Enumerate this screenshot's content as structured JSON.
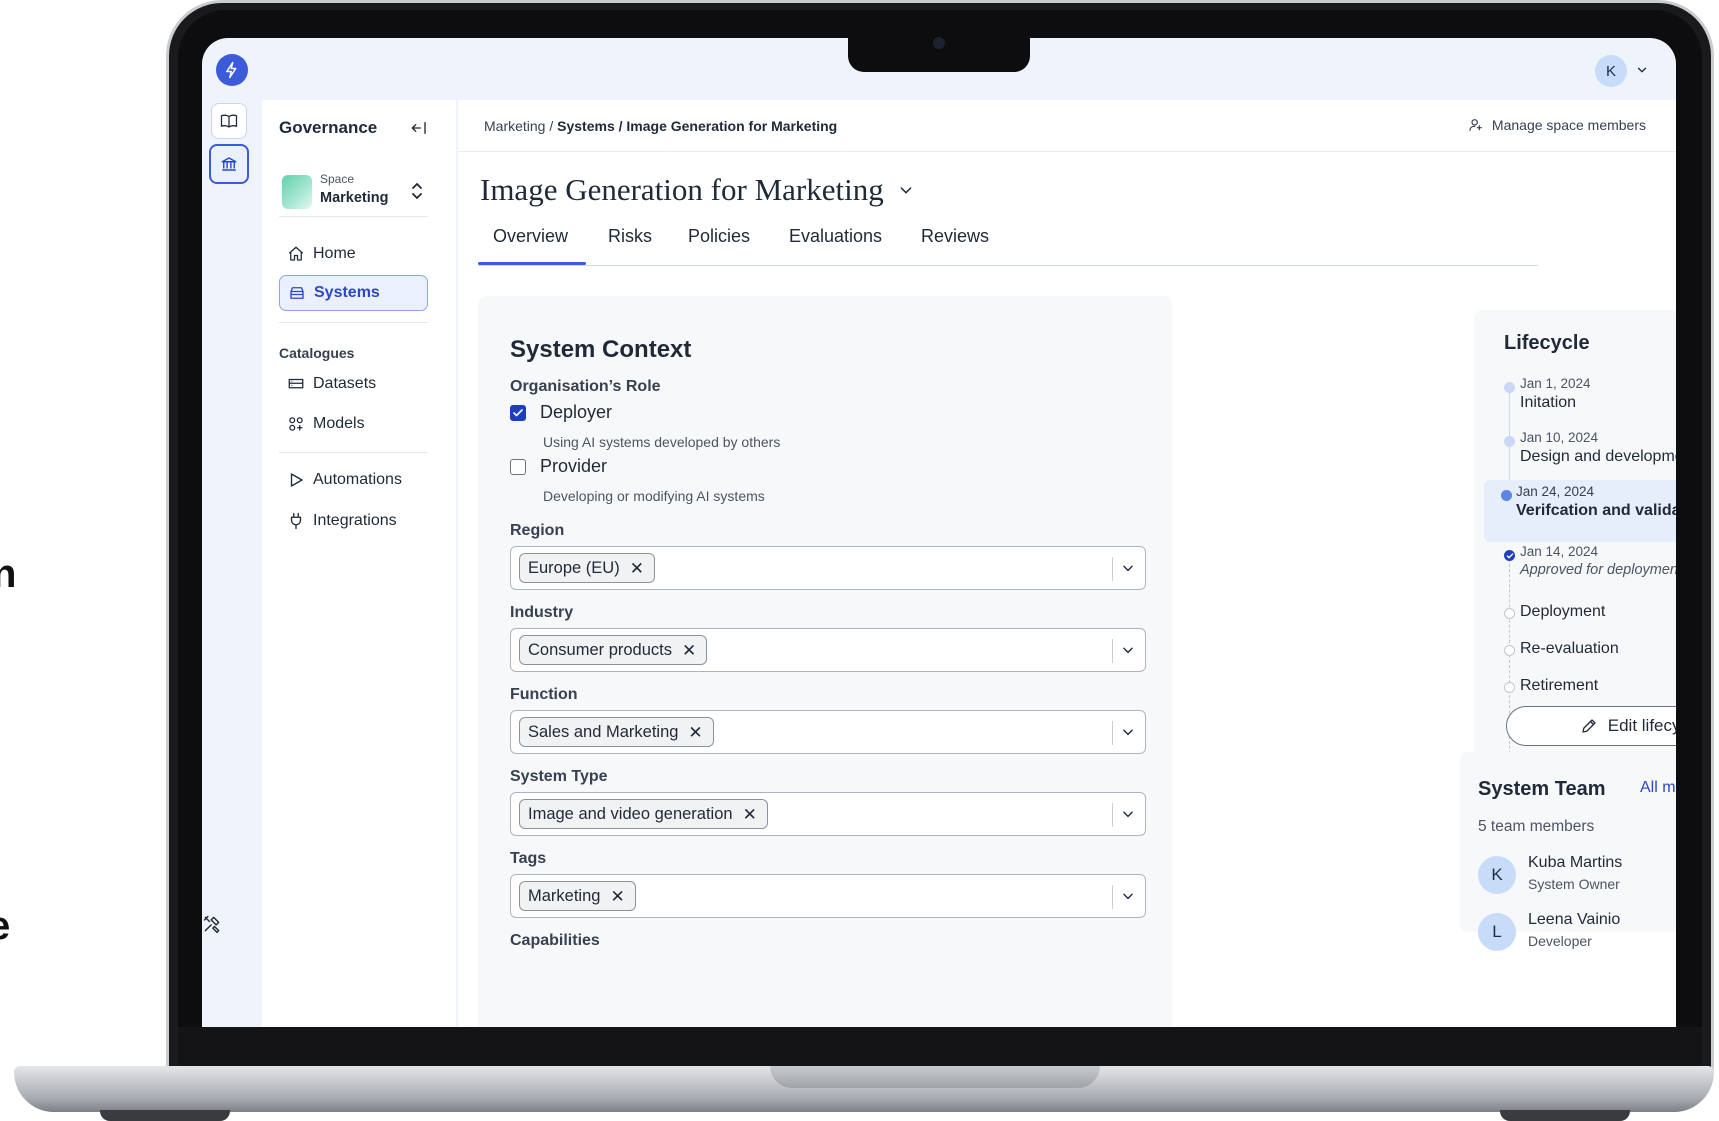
{
  "background": {
    "edge_chars": [
      "n",
      "e"
    ]
  },
  "app": {
    "user_initial": "K",
    "accent": "#3b5bdb"
  },
  "sidebar": {
    "title": "Governance",
    "space": {
      "label": "Space",
      "name": "Marketing"
    },
    "nav": [
      {
        "label": "Home",
        "icon": "home-icon",
        "active": false
      },
      {
        "label": "Systems",
        "icon": "systems-icon",
        "active": true
      }
    ],
    "catalogues_heading": "Catalogues",
    "catalogues": [
      {
        "label": "Datasets",
        "icon": "datasets-icon"
      },
      {
        "label": "Models",
        "icon": "models-icon"
      }
    ],
    "tools": [
      {
        "label": "Automations",
        "icon": "play-icon"
      },
      {
        "label": "Integrations",
        "icon": "plug-icon"
      }
    ]
  },
  "header": {
    "breadcrumb": {
      "root": "Marketing",
      "sep": " / ",
      "middle": "Systems",
      "current": "Image Generation for Marketing"
    },
    "manage_members": "Manage space members"
  },
  "page": {
    "title": "Image Generation for Marketing",
    "tabs": [
      "Overview",
      "Risks",
      "Policies",
      "Evaluations",
      "Reviews"
    ],
    "active_tab": "Overview"
  },
  "context": {
    "title": "System Context",
    "role_label": "Organisation’s Role",
    "roles": [
      {
        "label": "Deployer",
        "description": "Using AI systems developed by others",
        "checked": true
      },
      {
        "label": "Provider",
        "description": "Developing or modifying AI systems",
        "checked": false
      }
    ],
    "fields": [
      {
        "label": "Region",
        "chip": "Europe (EU)"
      },
      {
        "label": "Industry",
        "chip": "Consumer products"
      },
      {
        "label": "Function",
        "chip": "Sales and Marketing"
      },
      {
        "label": "System Type",
        "chip": "Image and video generation"
      },
      {
        "label": "Tags",
        "chip": "Marketing"
      }
    ],
    "capabilities_label": "Capabilities"
  },
  "lifecycle": {
    "title": "Lifecycle",
    "steps": [
      {
        "date": "Jan 1, 2024",
        "name": "Initation"
      },
      {
        "date": "Jan 10, 2024",
        "name": "Design and development"
      },
      {
        "date": "Jan 24, 2024",
        "name": "Verifcation and validation"
      },
      {
        "date": "Jan 14, 2024",
        "name": "Approved for deployment"
      },
      {
        "name": "Deployment"
      },
      {
        "name": "Re-evaluation"
      },
      {
        "name": "Retirement"
      }
    ],
    "edit_label": "Edit lifecycle"
  },
  "team": {
    "title": "System Team",
    "all_members": "All members",
    "count": "5 team members",
    "members": [
      {
        "initial": "K",
        "name": "Kuba Martins",
        "role": "System Owner"
      },
      {
        "initial": "L",
        "name": "Leena Vainio",
        "role": "Developer"
      }
    ]
  }
}
